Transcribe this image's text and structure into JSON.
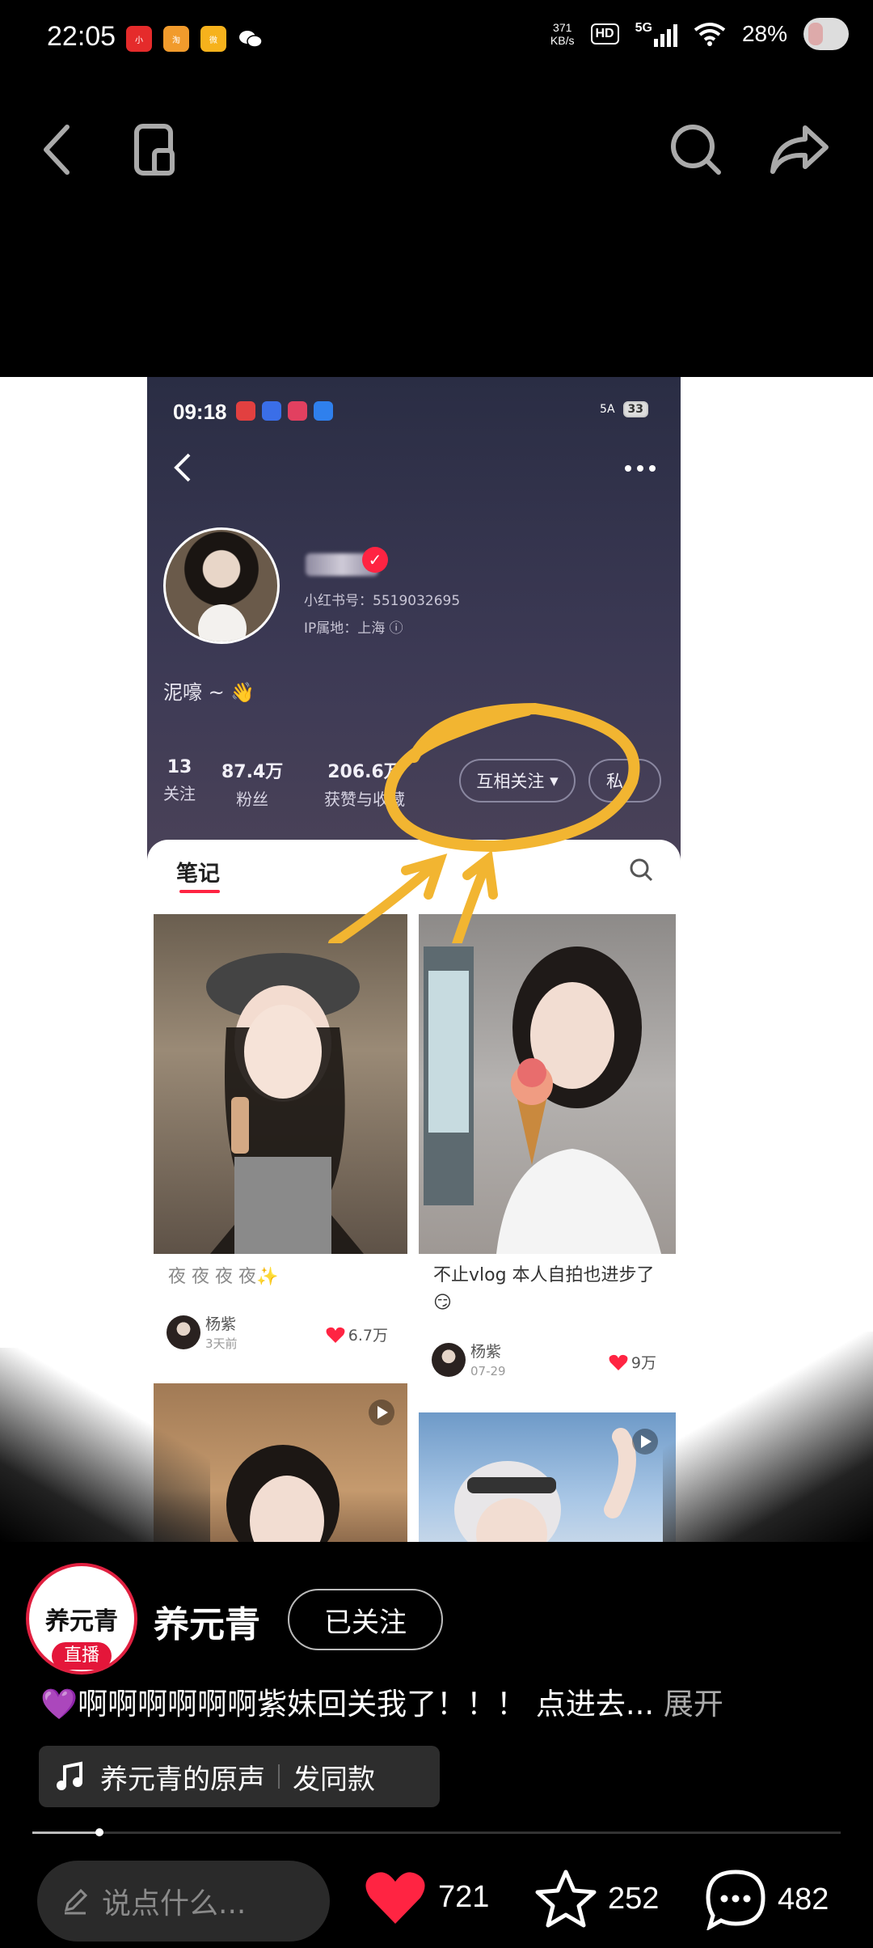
{
  "status_bar": {
    "time": "22:05",
    "net_speed_top": "371",
    "net_speed_bottom": "KB/s",
    "hd": "HD",
    "network": "5G",
    "battery": "28%"
  },
  "inner_screen": {
    "time": "09:18",
    "battery": "33",
    "network_tag": "5A",
    "profile": {
      "id_text": "小红书号：5519032695",
      "ip_text": "IP属地：上海 ⓘ",
      "bio": "泥嚎 ~ 👋",
      "stats": [
        {
          "num": "13",
          "label": "关注"
        },
        {
          "num": "87.4万",
          "label": "粉丝"
        },
        {
          "num": "206.6万",
          "label": "获赞与收藏"
        }
      ],
      "mutual_follow": "互相关注",
      "message_btn": "私"
    },
    "tab_notes": "笔记",
    "cards": [
      {
        "title": "夜 夜 夜 夜✨",
        "author": "杨紫",
        "date": "3天前",
        "likes": "6.7万"
      },
      {
        "title": "不止vlog 本人自拍也进步了😏",
        "author": "杨紫",
        "date": "07-29",
        "likes": "9万"
      }
    ]
  },
  "author": {
    "name": "养元青",
    "avatar_text": "养元青",
    "live_badge": "直播",
    "follow_label": "已关注"
  },
  "caption": {
    "text": "💜啊啊啊啊啊啊紫妹回关我了！！！ 点进去...",
    "expand": "展开"
  },
  "music": {
    "label": "养元青的原声",
    "same_style": "发同款"
  },
  "progress": {
    "fraction": 0.083
  },
  "bottom_bar": {
    "comment_placeholder": "说点什么...",
    "likes": "721",
    "favorites": "252",
    "comments": "482"
  },
  "colors": {
    "like_red": "#ff2442",
    "live_red": "#e4163a",
    "highlight_yellow": "#f2b531"
  }
}
